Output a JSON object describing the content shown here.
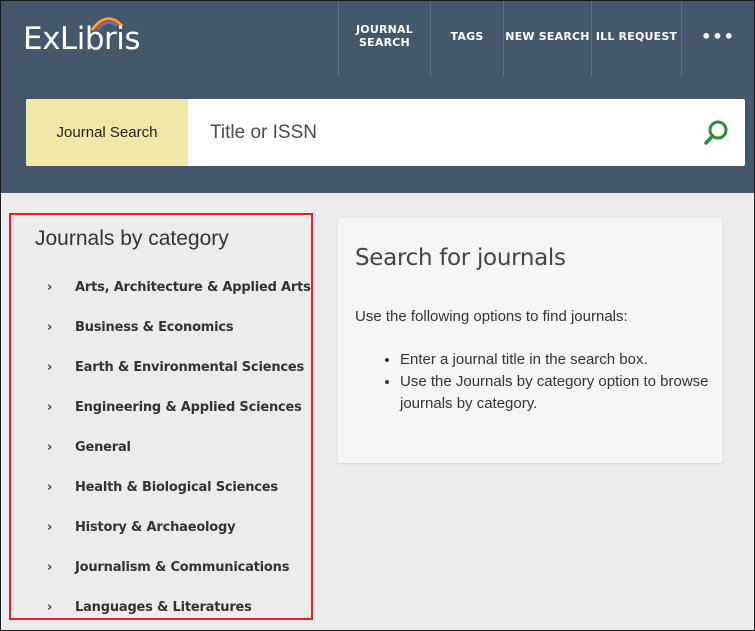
{
  "header": {
    "logo": "ExLibris",
    "nav": [
      {
        "label": "JOURNAL\nSEARCH"
      },
      {
        "label": "TAGS"
      },
      {
        "label": "NEW SEARCH"
      },
      {
        "label": "ILL REQUEST"
      },
      {
        "label": "•••"
      }
    ]
  },
  "search": {
    "scope": "Journal Search",
    "placeholder": "Title or ISSN",
    "value": ""
  },
  "categories": {
    "title": "Journals by category",
    "items": [
      {
        "label": "Arts, Architecture & Applied Arts"
      },
      {
        "label": "Business & Economics"
      },
      {
        "label": "Earth & Environmental Sciences"
      },
      {
        "label": "Engineering & Applied Sciences"
      },
      {
        "label": "General"
      },
      {
        "label": "Health & Biological Sciences"
      },
      {
        "label": "History & Archaeology"
      },
      {
        "label": "Journalism & Communications"
      },
      {
        "label": "Languages & Literatures"
      }
    ],
    "chevron": "›"
  },
  "help": {
    "title": "Search for journals",
    "intro": "Use the following options to find journals:",
    "bullets": [
      "Enter a journal title in the search box.",
      "Use the Journals by category option to browse journals by category."
    ]
  },
  "colors": {
    "header_bg": "#44576b",
    "scope_bg": "#f1e7a6",
    "search_icon": "#2f8a3a",
    "highlight_border": "#e52128"
  },
  "icons": {
    "search_button": "search-icon",
    "category_chevron": "chevron-right-icon",
    "more": "more-dots-icon"
  }
}
